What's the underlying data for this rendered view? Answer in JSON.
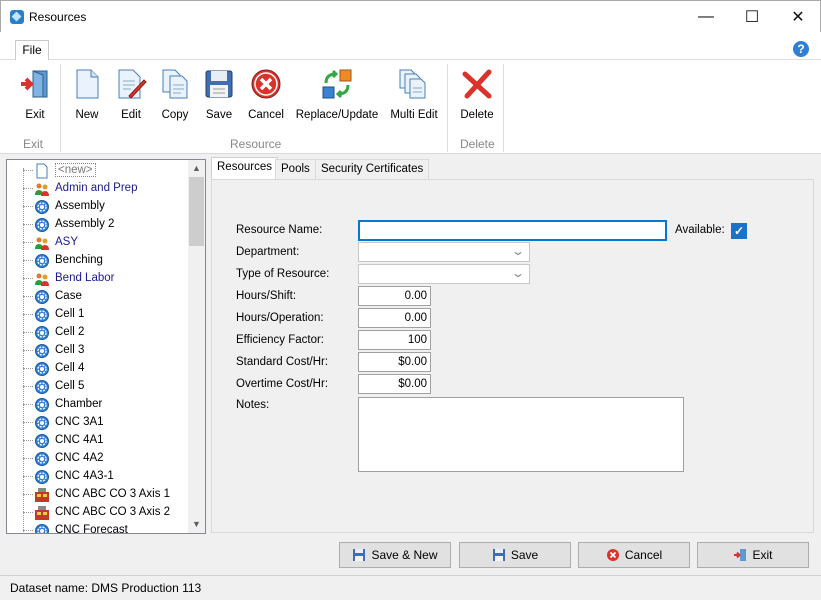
{
  "window": {
    "title": "Resources",
    "minimize": "—",
    "maximize": "☐",
    "close": "✕"
  },
  "ribbon_tabs": {
    "file": "File",
    "help": "?"
  },
  "ribbon": {
    "buttons": {
      "exit": "Exit",
      "new": "New",
      "edit": "Edit",
      "copy": "Copy",
      "save": "Save",
      "cancel": "Cancel",
      "replace_update": "Replace/Update",
      "multi_edit": "Multi Edit",
      "delete": "Delete"
    },
    "groups": {
      "exit": "Exit",
      "resource": "Resource",
      "delete": "Delete"
    }
  },
  "tree": {
    "items": [
      {
        "label": "<new>",
        "icon": "page-icon"
      },
      {
        "label": "Admin and Prep",
        "icon": "people-icon"
      },
      {
        "label": "Assembly",
        "icon": "gear-icon"
      },
      {
        "label": "Assembly 2",
        "icon": "gear-icon"
      },
      {
        "label": "ASY",
        "icon": "people-icon"
      },
      {
        "label": "Benching",
        "icon": "gear-icon"
      },
      {
        "label": "Bend Labor",
        "icon": "people-icon"
      },
      {
        "label": "Case",
        "icon": "gear-icon"
      },
      {
        "label": "Cell 1",
        "icon": "gear-icon"
      },
      {
        "label": "Cell 2",
        "icon": "gear-icon"
      },
      {
        "label": "Cell 3",
        "icon": "gear-icon"
      },
      {
        "label": "Cell 4",
        "icon": "gear-icon"
      },
      {
        "label": "Cell 5",
        "icon": "gear-icon"
      },
      {
        "label": "Chamber",
        "icon": "gear-icon"
      },
      {
        "label": "CNC 3A1",
        "icon": "gear-icon"
      },
      {
        "label": "CNC 4A1",
        "icon": "gear-icon"
      },
      {
        "label": "CNC 4A2",
        "icon": "gear-icon"
      },
      {
        "label": "CNC 4A3-1",
        "icon": "gear-icon"
      },
      {
        "label": "CNC ABC CO 3 Axis 1",
        "icon": "machine-icon"
      },
      {
        "label": "CNC ABC CO 3 Axis 2",
        "icon": "machine-icon"
      },
      {
        "label": "CNC Forecast",
        "icon": "gear-icon"
      }
    ],
    "colors": {
      "labor": "#1a1a8c",
      "default": "#000000",
      "new": "#7a7a7a"
    }
  },
  "tabs": [
    "Resources",
    "Pools",
    "Security Certificates"
  ],
  "form": {
    "resource_name_label": "Resource Name:",
    "resource_name_value": "",
    "available_label": "Available:",
    "available_checked": true,
    "department_label": "Department:",
    "department_value": "",
    "type_label": "Type of Resource:",
    "type_value": "",
    "hours_shift_label": "Hours/Shift:",
    "hours_shift_value": "0.00",
    "hours_operation_label": "Hours/Operation:",
    "hours_operation_value": "0.00",
    "efficiency_label": "Efficiency Factor:",
    "efficiency_value": "100",
    "std_cost_label": "Standard Cost/Hr:",
    "std_cost_value": "$0.00",
    "ot_cost_label": "Overtime Cost/Hr:",
    "ot_cost_value": "$0.00",
    "notes_label": "Notes:",
    "notes_value": ""
  },
  "bottom_buttons": {
    "save_new": "Save & New",
    "save": "Save",
    "cancel": "Cancel",
    "exit": "Exit"
  },
  "status": {
    "dataset": "Dataset name:  DMS Production 113"
  }
}
